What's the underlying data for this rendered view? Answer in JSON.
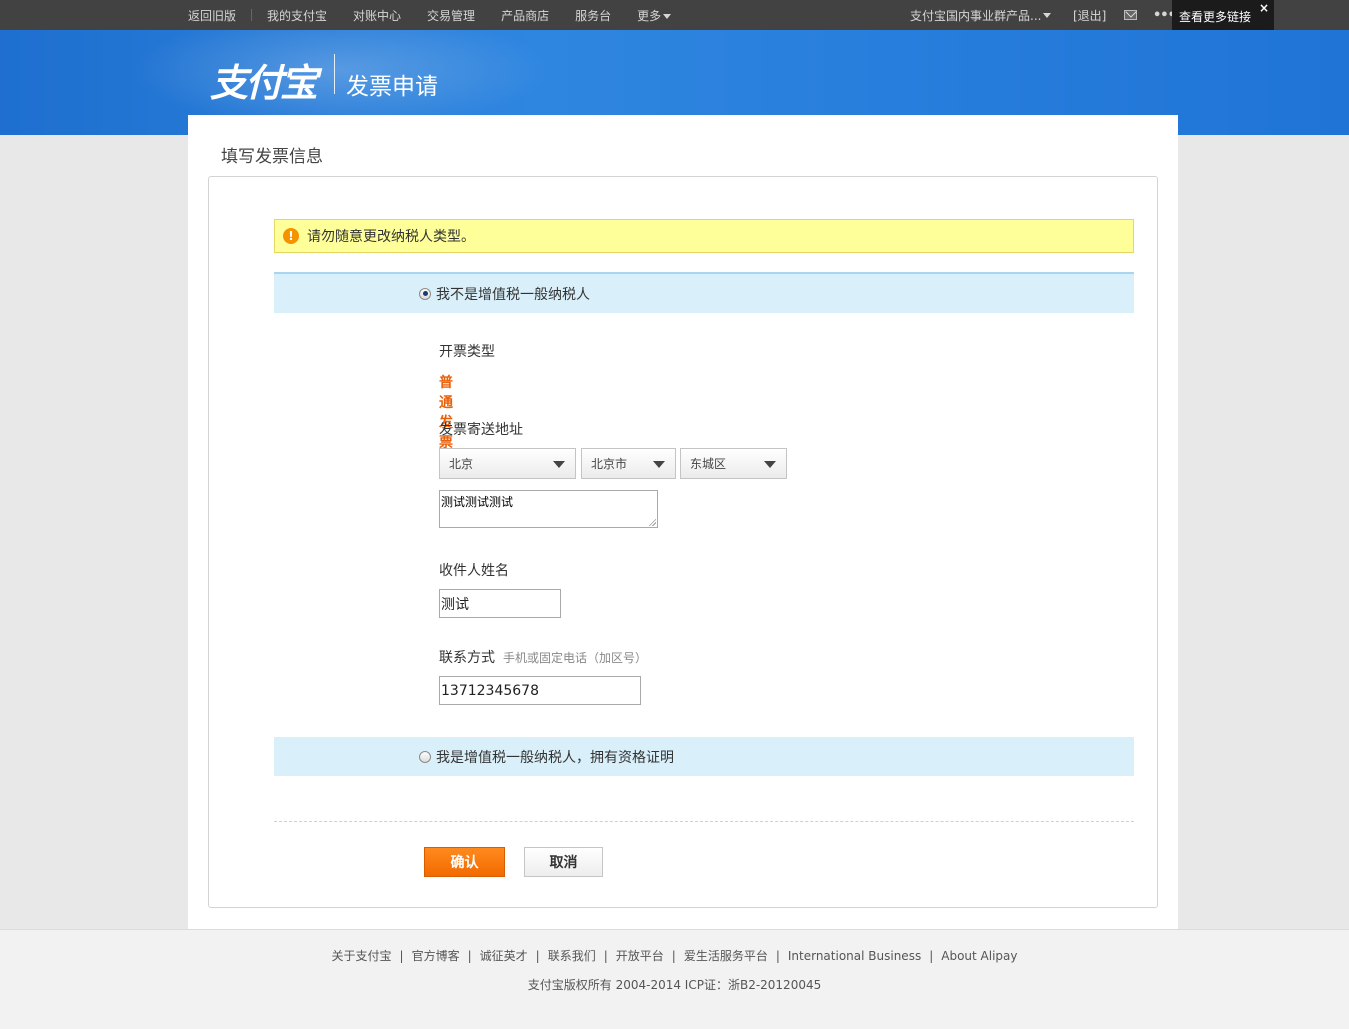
{
  "topnav": {
    "back_old": "返回旧版",
    "my_alipay": "我的支付宝",
    "reconcile": "对账中心",
    "trade": "交易管理",
    "shop": "产品商店",
    "service": "服务台",
    "more": "更多"
  },
  "topright": {
    "account": "支付宝国内事业群产品...",
    "logout": "[退出]",
    "tooltip": "查看更多链接",
    "close": "×"
  },
  "header": {
    "logo": "支付宝",
    "subtitle": "发票申请"
  },
  "page": {
    "title": "填写发票信息",
    "notice": "请勿随意更改纳税人类型。"
  },
  "options": {
    "not_general": "我不是增值税一般纳税人",
    "general": "我是增值税一般纳税人，拥有资格证明"
  },
  "form": {
    "invoice_type_label": "开票类型",
    "invoice_type_value": "普通发票",
    "address_label": "发票寄送地址",
    "province": "北京",
    "city": "北京市",
    "district": "东城区",
    "address_detail": "测试测试测试",
    "recipient_label": "收件人姓名",
    "recipient_value": "测试",
    "contact_label": "联系方式",
    "contact_hint": "手机或固定电话（加区号）",
    "contact_value": "13712345678"
  },
  "buttons": {
    "confirm": "确认",
    "cancel": "取消"
  },
  "footer": {
    "links": [
      "关于支付宝",
      "官方博客",
      "诚征英才",
      "联系我们",
      "开放平台",
      "爱生活服务平台",
      "International Business",
      "About Alipay"
    ],
    "copyright": "支付宝版权所有 2004-2014 ICP证：浙B2-20120045"
  }
}
